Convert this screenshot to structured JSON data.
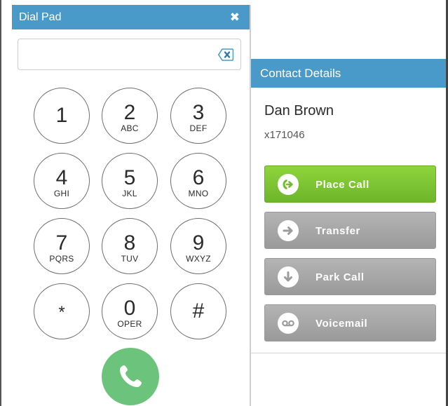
{
  "dialpad": {
    "title": "Dial Pad",
    "close_glyph": "✖",
    "input_value": "",
    "keys": [
      {
        "digit": "1",
        "letters": ""
      },
      {
        "digit": "2",
        "letters": "ABC"
      },
      {
        "digit": "3",
        "letters": "DEF"
      },
      {
        "digit": "4",
        "letters": "GHI"
      },
      {
        "digit": "5",
        "letters": "JKL"
      },
      {
        "digit": "6",
        "letters": "MNO"
      },
      {
        "digit": "7",
        "letters": "PQRS"
      },
      {
        "digit": "8",
        "letters": "TUV"
      },
      {
        "digit": "9",
        "letters": "WXYZ"
      },
      {
        "digit": "*",
        "letters": ""
      },
      {
        "digit": "0",
        "letters": "OPER"
      },
      {
        "digit": "#",
        "letters": ""
      }
    ],
    "call_icon": "phone-icon"
  },
  "contact": {
    "header": "Contact Details",
    "name": "Dan Brown",
    "extension": "x171046"
  },
  "actions": [
    {
      "label": "Place Call",
      "icon": "place-call-icon",
      "style": "green"
    },
    {
      "label": "Transfer",
      "icon": "arrow-right-icon",
      "style": "gray"
    },
    {
      "label": "Park Call",
      "icon": "arrow-down-icon",
      "style": "gray"
    },
    {
      "label": "Voicemail",
      "icon": "voicemail-icon",
      "style": "gray"
    }
  ],
  "colors": {
    "header_blue": "#4a9ac9",
    "call_green": "#6cc37c",
    "place_call_green": "#7cc232",
    "action_gray": "#a8a8a8"
  }
}
